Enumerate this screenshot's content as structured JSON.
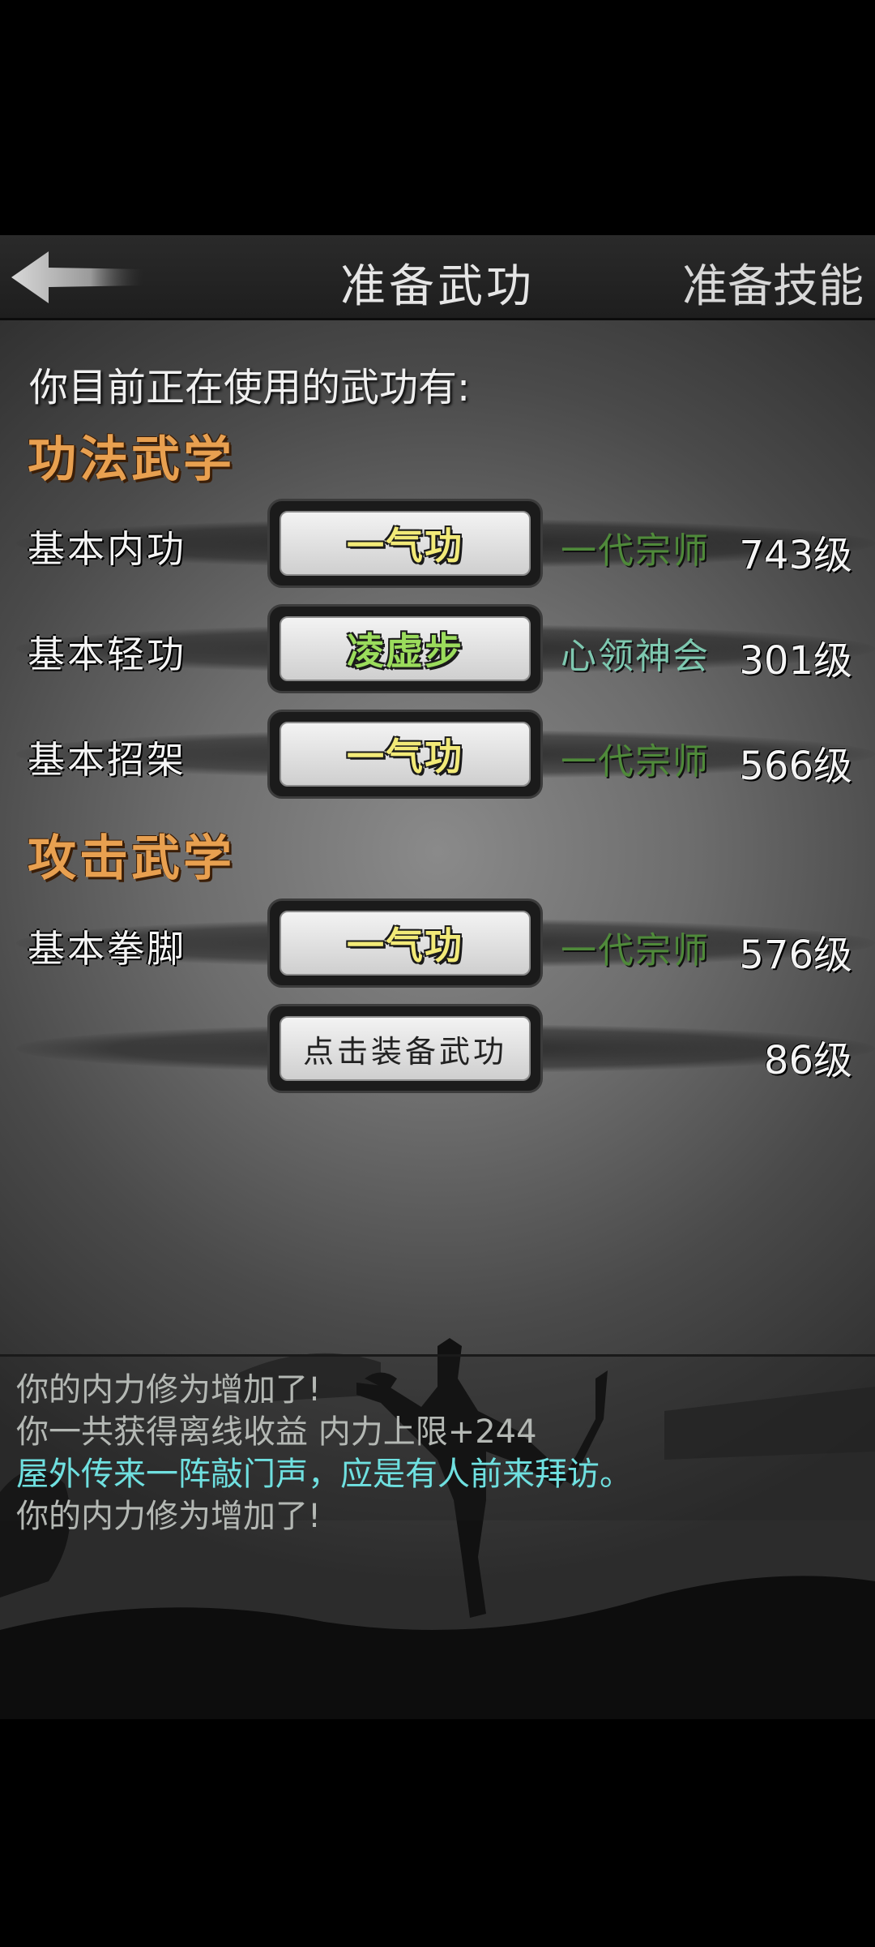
{
  "header": {
    "title": "准备武功",
    "right_label": "准备技能"
  },
  "intro_text": "你目前正在使用的武功有:",
  "sections": [
    {
      "title": "功法武学",
      "rows": [
        {
          "label": "基本内功",
          "skill": "一气功",
          "skill_color": "yellow",
          "rank": "一代宗师",
          "rank_color": "green-dark",
          "level": "743级"
        },
        {
          "label": "基本轻功",
          "skill": "凌虚步",
          "skill_color": "green",
          "rank": "心领神会",
          "rank_color": "teal",
          "level": "301级"
        },
        {
          "label": "基本招架",
          "skill": "一气功",
          "skill_color": "yellow",
          "rank": "一代宗师",
          "rank_color": "green-dark",
          "level": "566级"
        }
      ]
    },
    {
      "title": "攻击武学",
      "rows": [
        {
          "label": "基本拳脚",
          "skill": "一气功",
          "skill_color": "yellow",
          "rank": "一代宗师",
          "rank_color": "green-dark",
          "level": "576级"
        },
        {
          "label": "",
          "skill": "点击装备武功",
          "skill_color": "plain",
          "rank": "",
          "rank_color": "",
          "level": "86级"
        }
      ]
    }
  ],
  "log": [
    {
      "text": "你的内力修为增加了!",
      "color": "gray"
    },
    {
      "text": "你一共获得离线收益 内力上限+244",
      "color": "gray"
    },
    {
      "text": "屋外传来一阵敲门声，应是有人前来拜访。",
      "color": "cyan"
    },
    {
      "text": "你的内力修为增加了!",
      "color": "gray"
    }
  ],
  "colors": {
    "section_title": "#e8a050",
    "skill_yellow": "#f2ea78",
    "skill_green": "#9bdc5c",
    "rank_green": "#4f8a3a",
    "rank_teal": "#7ec8b0",
    "log_cyan": "#6fe0e0",
    "log_gray": "#b4b8b4"
  },
  "icons": {
    "back": "back-arrow-icon"
  }
}
